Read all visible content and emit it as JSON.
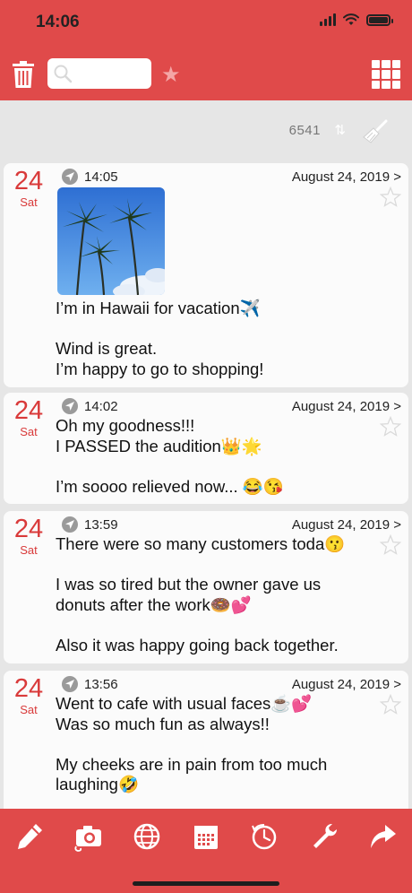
{
  "status_bar": {
    "time": "14:06"
  },
  "header": {
    "search_placeholder": "",
    "icons": [
      "trash-icon",
      "search-icon",
      "star-icon",
      "grid-icon"
    ]
  },
  "toolbar": {
    "count": "6541",
    "sort_symbol": "⇅",
    "icons": [
      "sort-icon",
      "broom-icon"
    ]
  },
  "entries": [
    {
      "day": "24",
      "weekday": "Sat",
      "time": "14:05",
      "date": "August 24, 2019 >",
      "has_photo": true,
      "body": "I’m in Hawaii for vacation✈️\n\nWind is great.\nI’m happy to go to shopping!"
    },
    {
      "day": "24",
      "weekday": "Sat",
      "time": "14:02",
      "date": "August 24, 2019 >",
      "has_photo": false,
      "body": "Oh my goodness!!!\nI PASSED the audition👑🌟\n\nI’m soooo relieved now... 😂😘"
    },
    {
      "day": "24",
      "weekday": "Sat",
      "time": "13:59",
      "date": "August 24, 2019 >",
      "has_photo": false,
      "body": "There were so many customers toda😗\n\nI was so tired but the owner gave us\ndonuts after the work🍩💕\n\nAlso it was happy going back together."
    },
    {
      "day": "24",
      "weekday": "Sat",
      "time": "13:56",
      "date": "August 24, 2019 >",
      "has_photo": false,
      "body": "Went to cafe with usual faces☕️💕\nWas so much fun as always!!\n\nMy cheeks are in pain from too much\nlaughing🤣"
    }
  ],
  "bottom_bar": {
    "icons": [
      "pencil-icon",
      "camera-icon",
      "globe-icon",
      "calendar-icon",
      "clock-icon",
      "wrench-icon",
      "share-icon"
    ]
  },
  "colors": {
    "accent": "#e04a4a",
    "date_red": "#d93a3a",
    "background": "#e6e6e6",
    "card": "#fbfbfb"
  }
}
